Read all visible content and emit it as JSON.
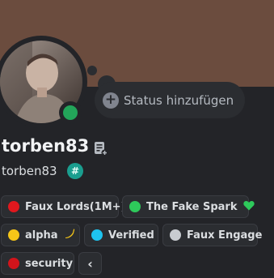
{
  "profile": {
    "display_name": "torben83",
    "username": "torben83",
    "status_placeholder": "Status hinzufügen",
    "online_status_color": "#23a55a",
    "banner_color": "#6b4c3e"
  },
  "roles": [
    {
      "label": "Faux Lords(1M+)",
      "color": "#e0181e"
    },
    {
      "label": "The Fake Spark",
      "color": "#2ec95b",
      "emoji": "💚"
    },
    {
      "label": "alpha",
      "color": "#f5c518",
      "emoji": "🫡"
    },
    {
      "label": "Verified",
      "color": "#1ec4f0"
    },
    {
      "label": "Faux Engage",
      "color": "#c8ccd1"
    },
    {
      "label": "security",
      "color": "#d2141b"
    }
  ],
  "icons": {
    "add": "plus-icon",
    "note": "note-icon",
    "collapse": "chevron-left-icon",
    "badge": "hash-icon"
  },
  "labels": {
    "badge_glyph": "#",
    "collapse_glyph": "‹"
  }
}
